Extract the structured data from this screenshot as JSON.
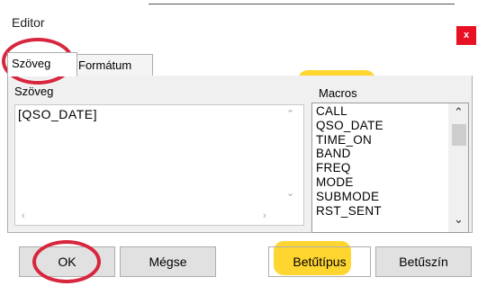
{
  "window": {
    "title": "Editor",
    "close_label": "x"
  },
  "tabs": [
    {
      "label": "Szöveg",
      "active": true
    },
    {
      "label": "Formátum",
      "active": false
    }
  ],
  "text_group": {
    "label": "Szöveg",
    "value": "[QSO_DATE]"
  },
  "macros_group": {
    "label": "Macros",
    "items": [
      "CALL",
      "QSO_DATE",
      "TIME_ON",
      "BAND",
      "FREQ",
      "MODE",
      "SUBMODE",
      "RST_SENT"
    ]
  },
  "buttons": {
    "ok": "OK",
    "cancel": "Mégse",
    "font": "Betűtípus",
    "font_color": "Betűszín"
  },
  "colors": {
    "close_bg": "#e81123",
    "highlight": "#ffd21a",
    "annotation_circle": "#d7263d"
  }
}
